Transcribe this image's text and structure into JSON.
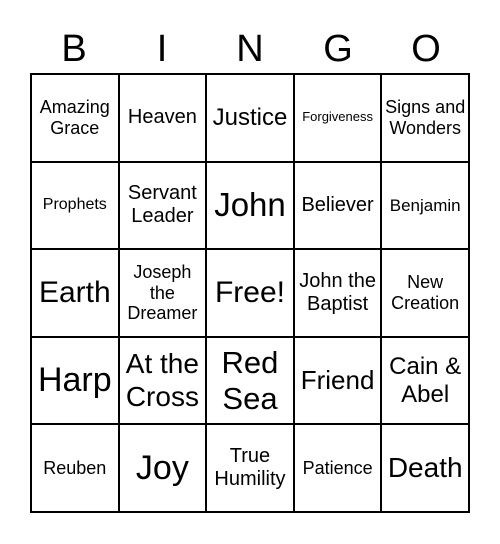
{
  "header": [
    "B",
    "I",
    "N",
    "G",
    "O"
  ],
  "cells": [
    "Amazing Grace",
    "Heaven",
    "Justice",
    "Forgiveness",
    "Signs and Wonders",
    "Prophets",
    "Servant Leader",
    "John",
    "Believer",
    "Benjamin",
    "Earth",
    "Joseph the Dreamer",
    "Free!",
    "John the Baptist",
    "New Creation",
    "Harp",
    "At the Cross",
    "Red Sea",
    "Friend",
    "Cain & Abel",
    "Reuben",
    "Joy",
    "True Humility",
    "Patience",
    "Death"
  ]
}
